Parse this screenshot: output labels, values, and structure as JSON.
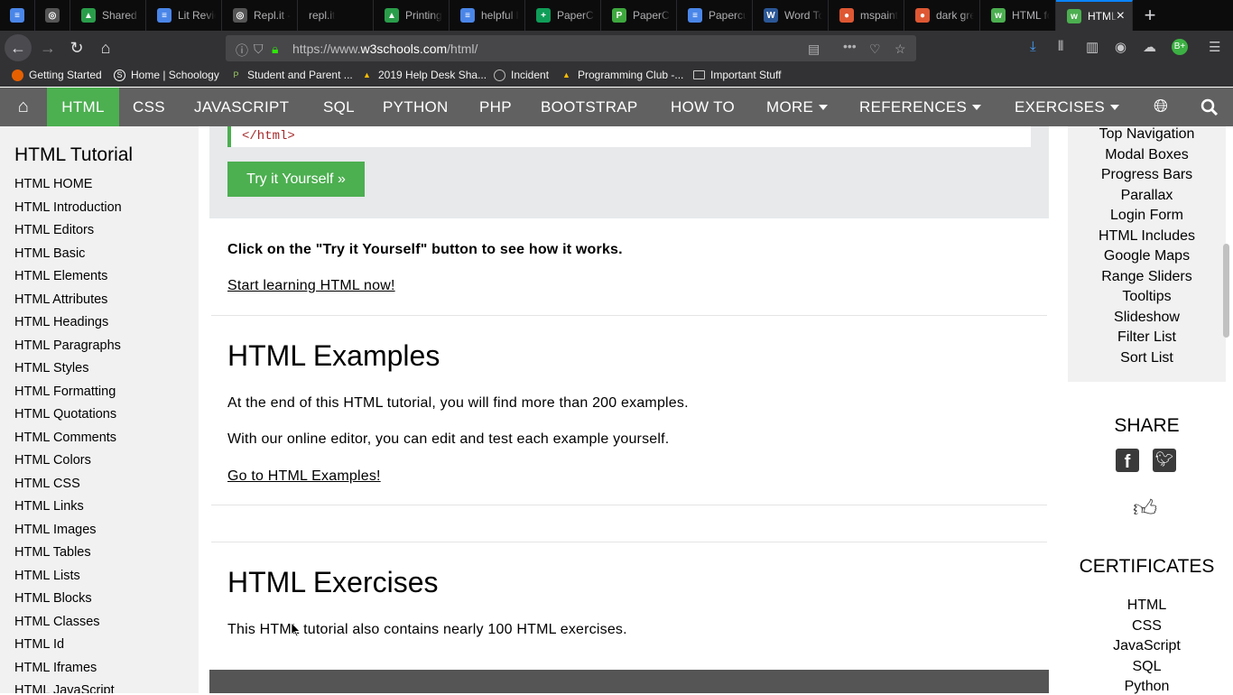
{
  "browser": {
    "tabs": [
      {
        "label": "",
        "icon_color": "#4a86e8",
        "icon_char": "≡"
      },
      {
        "label": "",
        "icon_color": "#555",
        "icon_char": "◎"
      },
      {
        "label": "Shared w",
        "icon_color": "#2a9d4a",
        "icon_char": "▲"
      },
      {
        "label": "Lit Revie",
        "icon_color": "#4a86e8",
        "icon_char": "≡"
      },
      {
        "label": "Repl.it - ",
        "icon_color": "#555",
        "icon_char": "◎"
      },
      {
        "label": "repl.it",
        "icon_color": "#555",
        "icon_char": ""
      },
      {
        "label": "Printing",
        "icon_color": "#2a9d4a",
        "icon_char": "▲"
      },
      {
        "label": "helpful lin",
        "icon_color": "#4a86e8",
        "icon_char": "≡"
      },
      {
        "label": "PaperCut",
        "icon_color": "#0f9d58",
        "icon_char": "+"
      },
      {
        "label": "PaperCut",
        "icon_color": "#3ea83e",
        "icon_char": "P"
      },
      {
        "label": "Papercut",
        "icon_color": "#4a86e8",
        "icon_char": "≡"
      },
      {
        "label": "Word To",
        "icon_color": "#2b5797",
        "icon_char": "W"
      },
      {
        "label": "mspaint c",
        "icon_color": "#de5833",
        "icon_char": "●"
      },
      {
        "label": "dark gree",
        "icon_color": "#de5833",
        "icon_char": "●"
      },
      {
        "label": "HTML for",
        "icon_color": "#4caf50",
        "icon_char": "w"
      },
      {
        "label": "HTML",
        "icon_color": "#4caf50",
        "icon_char": "w",
        "active": true
      }
    ],
    "url": {
      "prefix": "https://www.",
      "domain": "w3schools.com",
      "path": "/html/"
    },
    "bookmarks": [
      {
        "label": "Getting Started",
        "icon_color": "#e66000"
      },
      {
        "label": "Home | Schoology",
        "icon_color": "#ffffff"
      },
      {
        "label": "Student and Parent ...",
        "icon_color": "#2a9d4a"
      },
      {
        "label": "2019 Help Desk Sha...",
        "icon_color": "#fbbc04"
      },
      {
        "label": "Incident",
        "icon_color": "#bbbbbb"
      },
      {
        "label": "Programming Club -...",
        "icon_color": "#fbbc04"
      },
      {
        "label": "Important Stuff",
        "icon_color": "#cccccc"
      }
    ]
  },
  "w3nav": {
    "items": [
      "HTML",
      "CSS",
      "JAVASCRIPT",
      "SQL",
      "PYTHON",
      "PHP",
      "BOOTSTRAP",
      "HOW TO",
      "MORE",
      "REFERENCES",
      "EXERCISES"
    ],
    "active": "HTML"
  },
  "sidebar": {
    "title": "HTML Tutorial",
    "links": [
      "HTML HOME",
      "HTML Introduction",
      "HTML Editors",
      "HTML Basic",
      "HTML Elements",
      "HTML Attributes",
      "HTML Headings",
      "HTML Paragraphs",
      "HTML Styles",
      "HTML Formatting",
      "HTML Quotations",
      "HTML Comments",
      "HTML Colors",
      "HTML CSS",
      "HTML Links",
      "HTML Images",
      "HTML Tables",
      "HTML Lists",
      "HTML Blocks",
      "HTML Classes",
      "HTML Id",
      "HTML Iframes",
      "HTML JavaScript"
    ]
  },
  "main": {
    "code_line": "</html>",
    "try_button": "Try it Yourself »",
    "click_note": "Click on the \"Try it Yourself\" button to see how it works.",
    "start_link": "Start learning HTML now!",
    "examples_heading": "HTML Examples",
    "examples_p1": "At the end of this HTML tutorial, you will find more than 200 examples.",
    "examples_p2": "With our online editor, you can edit and test each example yourself.",
    "examples_link": "Go to HTML Examples!",
    "exercises_heading": "HTML Exercises",
    "exercises_p1": "This HTML tutorial also contains nearly 100 HTML exercises."
  },
  "right": {
    "menu": [
      "Top Navigation",
      "Modal Boxes",
      "Progress Bars",
      "Parallax",
      "Login Form",
      "HTML Includes",
      "Google Maps",
      "Range Sliders",
      "Tooltips",
      "Slideshow",
      "Filter List",
      "Sort List"
    ],
    "share_title": "SHARE",
    "certificates_title": "CERTIFICATES",
    "certificates": [
      "HTML",
      "CSS",
      "JavaScript",
      "SQL",
      "Python"
    ]
  },
  "colors": {
    "w3_green": "#4caf50",
    "w3_nav": "#616161",
    "browser_chrome": "#323234"
  }
}
